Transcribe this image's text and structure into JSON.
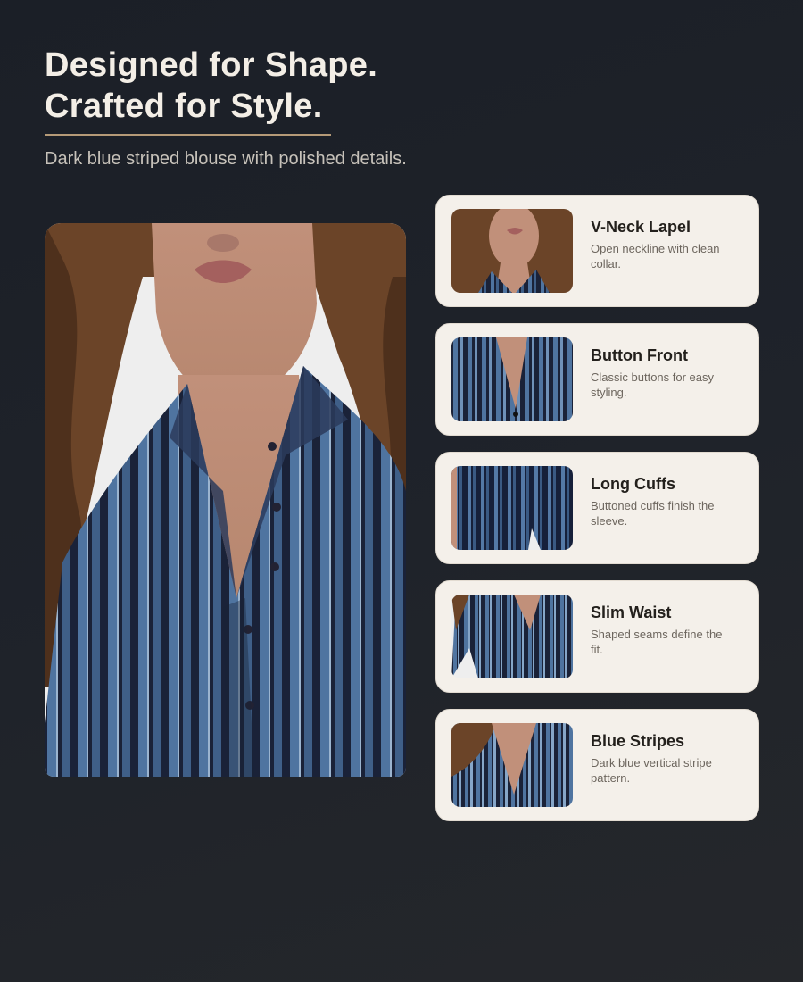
{
  "header": {
    "title_line1": "Designed for Shape.",
    "title_line2": "Crafted for Style.",
    "subtitle": "Dark blue striped blouse with polished details."
  },
  "hero_image": {
    "subject": "model wearing dark blue vertical-striped button-front blouse",
    "colors": {
      "navy": "#1a2238",
      "mid_blue": "#4f74a0",
      "light_blue": "#86a6c8",
      "hair": "#6b4428",
      "skin": "#c99a80"
    }
  },
  "features": [
    {
      "icon": "v-neck-lapel-thumbnail",
      "title": "V-Neck Lapel",
      "description": "Open neckline with clean collar."
    },
    {
      "icon": "button-front-thumbnail",
      "title": "Button Front",
      "description": "Classic buttons for easy styling."
    },
    {
      "icon": "long-cuffs-thumbnail",
      "title": "Long Cuffs",
      "description": "Buttoned cuffs finish the sleeve."
    },
    {
      "icon": "slim-waist-thumbnail",
      "title": "Slim Waist",
      "description": "Shaped seams define the fit."
    },
    {
      "icon": "blue-stripes-thumbnail",
      "title": "Blue Stripes",
      "description": "Dark blue vertical stripe pattern."
    }
  ],
  "theme": {
    "background": "#1e222a",
    "accent_rule": "#b59a78",
    "card_background": "#f4f0ea",
    "heading_text": "#f3eee6"
  }
}
